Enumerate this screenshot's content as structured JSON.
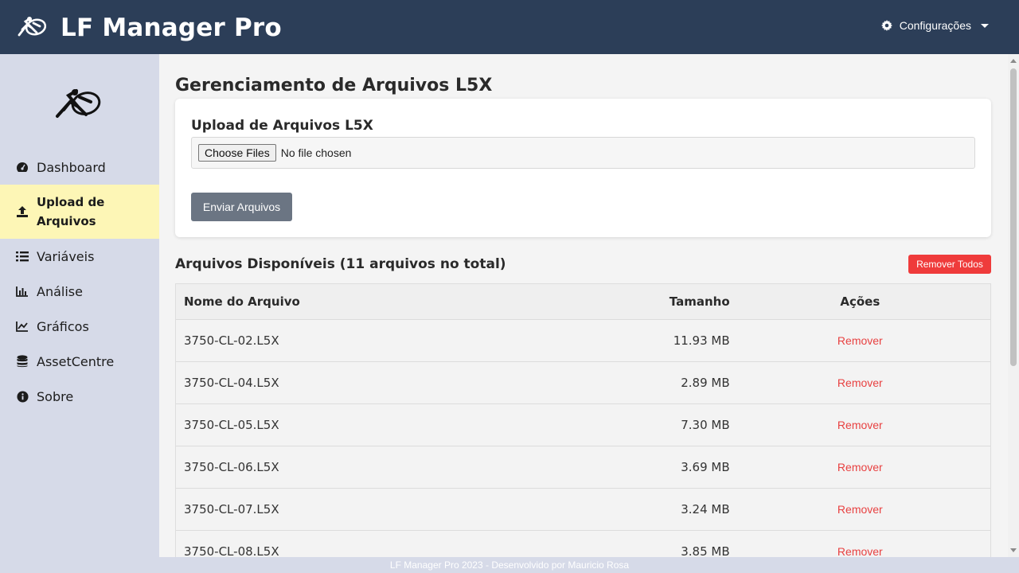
{
  "app": {
    "title": "LF Manager Pro"
  },
  "header": {
    "config_label": "Configurações"
  },
  "sidebar": {
    "items": [
      {
        "label": "Dashboard",
        "icon": "gauge-icon"
      },
      {
        "label": "Upload de Arquivos",
        "icon": "upload-icon",
        "active": true
      },
      {
        "label": "Variáveis",
        "icon": "list-icon"
      },
      {
        "label": "Análise",
        "icon": "bar-chart-icon"
      },
      {
        "label": "Gráficos",
        "icon": "line-chart-icon"
      },
      {
        "label": "AssetCentre",
        "icon": "database-icon"
      },
      {
        "label": "Sobre",
        "icon": "info-icon"
      }
    ]
  },
  "main": {
    "page_title": "Gerenciamento de Arquivos L5X",
    "upload": {
      "title": "Upload de Arquivos L5X",
      "choose_label": "Choose Files",
      "no_file_text": "No file chosen",
      "send_label": "Enviar Arquivos"
    },
    "files": {
      "title": "Arquivos Disponíveis (11 arquivos no total)",
      "remove_all_label": "Remover Todos",
      "columns": [
        "Nome do Arquivo",
        "Tamanho",
        "Ações"
      ],
      "rows": [
        {
          "name": "3750-CL-02.L5X",
          "size": "11.93 MB",
          "action": "Remover"
        },
        {
          "name": "3750-CL-04.L5X",
          "size": "2.89 MB",
          "action": "Remover"
        },
        {
          "name": "3750-CL-05.L5X",
          "size": "7.30 MB",
          "action": "Remover"
        },
        {
          "name": "3750-CL-06.L5X",
          "size": "3.69 MB",
          "action": "Remover"
        },
        {
          "name": "3750-CL-07.L5X",
          "size": "3.24 MB",
          "action": "Remover"
        },
        {
          "name": "3750-CL-08.L5X",
          "size": "3.85 MB",
          "action": "Remover"
        }
      ]
    }
  },
  "footer": {
    "text": "LF Manager Pro 2023 - Desenvolvido por Mauricio Rosa"
  },
  "colors": {
    "header_bg": "#2c3e58",
    "sidebar_bg": "#d6dae8",
    "active_item_bg": "#fdf6b6",
    "danger": "#ef3b3b",
    "send_button": "#6b7583"
  }
}
